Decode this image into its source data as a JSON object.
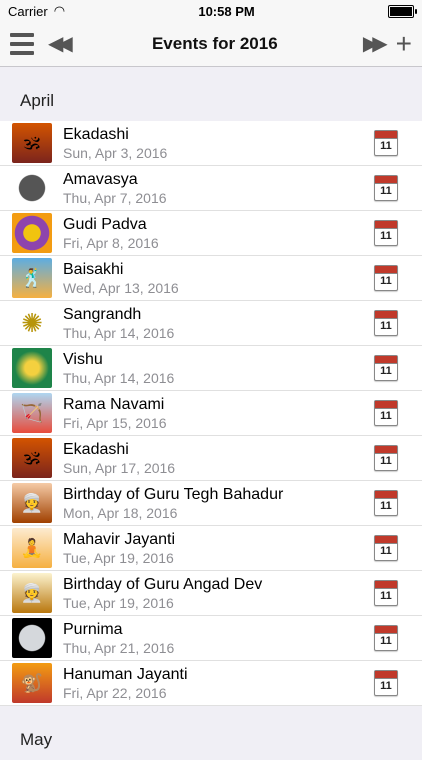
{
  "status": {
    "carrier": "Carrier",
    "time": "10:58 PM"
  },
  "nav": {
    "title": "Events for 2016"
  },
  "sections": [
    {
      "title": "April"
    },
    {
      "title": "May"
    }
  ],
  "events": [
    {
      "title": "Ekadashi",
      "date": "Sun, Apr 3, 2016"
    },
    {
      "title": "Amavasya",
      "date": "Thu, Apr 7, 2016"
    },
    {
      "title": "Gudi Padva",
      "date": "Fri, Apr 8, 2016"
    },
    {
      "title": "Baisakhi",
      "date": "Wed, Apr 13, 2016"
    },
    {
      "title": "Sangrandh",
      "date": "Thu, Apr 14, 2016"
    },
    {
      "title": "Vishu",
      "date": "Thu, Apr 14, 2016"
    },
    {
      "title": "Rama Navami",
      "date": "Fri, Apr 15, 2016"
    },
    {
      "title": "Ekadashi",
      "date": "Sun, Apr 17, 2016"
    },
    {
      "title": "Birthday of Guru Tegh Bahadur",
      "date": "Mon, Apr 18, 2016"
    },
    {
      "title": "Mahavir Jayanti",
      "date": "Tue, Apr 19, 2016"
    },
    {
      "title": "Birthday of Guru Angad Dev",
      "date": "Tue, Apr 19, 2016"
    },
    {
      "title": "Purnima",
      "date": "Thu, Apr 21, 2016"
    },
    {
      "title": "Hanuman Jayanti",
      "date": "Fri, Apr 22, 2016"
    }
  ],
  "calendar_icon_number": "11",
  "colors": {
    "nav_bg": "#f7f7f7",
    "section_bg": "#f0eff5",
    "date_text": "#8e8e93",
    "calendar_red": "#c0392b"
  },
  "icons": {
    "menu": "hamburger-icon",
    "previous": "rewind-icon",
    "next": "fast-forward-icon",
    "add": "plus-icon",
    "row_action": "calendar-icon"
  }
}
